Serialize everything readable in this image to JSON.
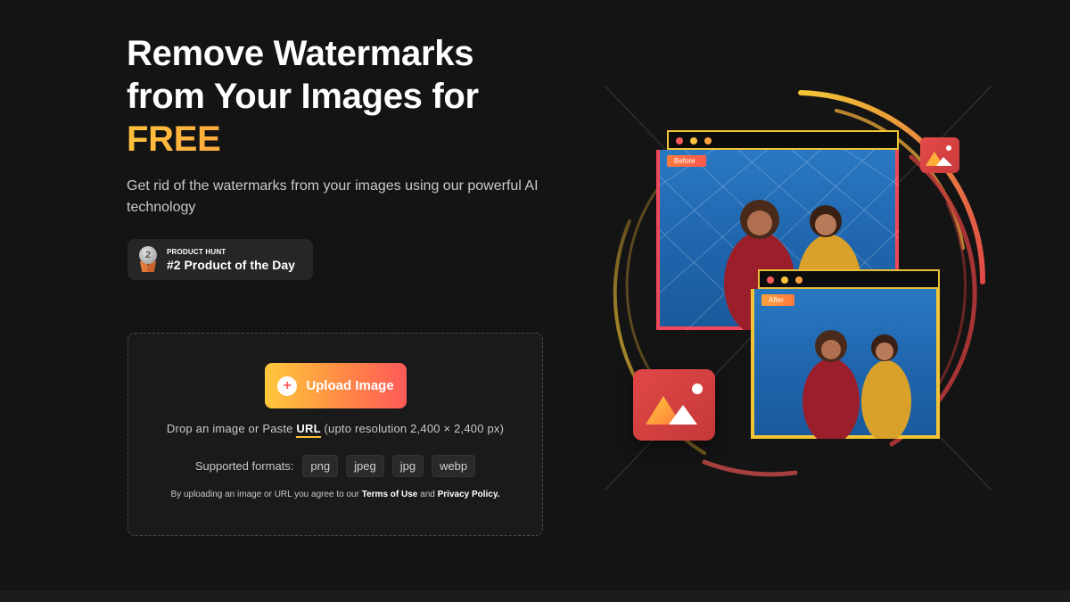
{
  "hero": {
    "title_line1": "Remove Watermarks",
    "title_line2": "from Your Images for",
    "title_highlight": "FREE",
    "subtitle": "Get rid of the watermarks from your images using our powerful AI technology"
  },
  "product_hunt": {
    "kicker": "PRODUCT HUNT",
    "title": "#2 Product of the Day",
    "rank": "2"
  },
  "upload": {
    "button_label": "Upload Image",
    "drop_prefix": "Drop an image or Paste",
    "url_label": "URL",
    "drop_suffix": "(upto resolution 2,400 × 2,400 px)",
    "formats_label": "Supported formats:",
    "formats": [
      "png",
      "jpeg",
      "jpg",
      "webp"
    ],
    "terms_prefix": "By uploading an image or URL you agree to our",
    "terms_link": "Terms of Use",
    "terms_and": "and",
    "privacy_link": "Privacy Policy."
  },
  "illustration": {
    "before_tag": "Before",
    "after_tag": "After"
  },
  "colors": {
    "background": "#141414",
    "accent_yellow": "#ffc23d",
    "accent_orange": "#ff8a3d",
    "accent_red": "#ff5a4e",
    "photo_blue": "#2a78c2"
  }
}
